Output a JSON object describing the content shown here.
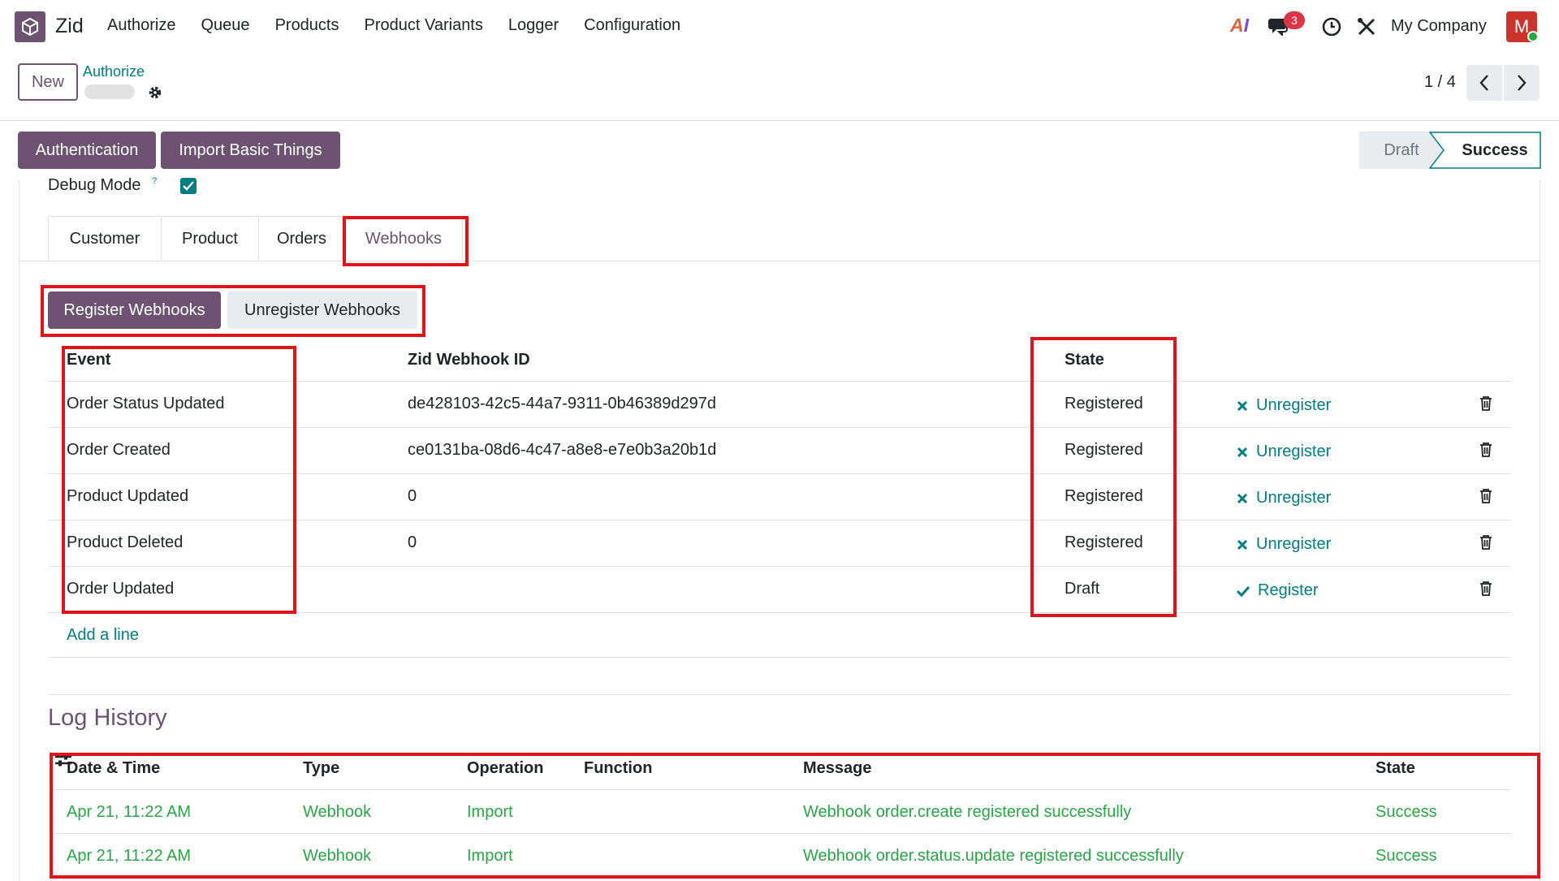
{
  "app": {
    "name": "Zid"
  },
  "nav": {
    "items": [
      "Authorize",
      "Queue",
      "Products",
      "Product Variants",
      "Logger",
      "Configuration"
    ]
  },
  "systray": {
    "chat_badge": "3",
    "company": "My Company",
    "avatar_initial": "M"
  },
  "control_panel": {
    "new_label": "New",
    "breadcrumb": "Authorize",
    "pager": "1 / 4"
  },
  "header_buttons": {
    "authentication": "Authentication",
    "import_basic": "Import Basic Things"
  },
  "statusbar": {
    "draft": "Draft",
    "success": "Success",
    "current": "Success"
  },
  "form": {
    "debug_label": "Debug Mode",
    "debug_sup": "?",
    "debug_checked": true
  },
  "tabs": [
    "Customer",
    "Product",
    "Orders",
    "Webhooks"
  ],
  "active_tab": "Webhooks",
  "webhooks": {
    "register_btn": "Register Webhooks",
    "unregister_btn": "Unregister Webhooks",
    "columns": {
      "event": "Event",
      "webhook_id": "Zid Webhook ID",
      "state": "State"
    },
    "rows": [
      {
        "event": "Order Status Updated",
        "webhook_id": "de428103-42c5-44a7-9311-0b46389d297d",
        "state": "Registered",
        "action": "Unregister"
      },
      {
        "event": "Order Created",
        "webhook_id": "ce0131ba-08d6-4c47-a8e8-e7e0b3a20b1d",
        "state": "Registered",
        "action": "Unregister"
      },
      {
        "event": "Product Updated",
        "webhook_id": "0",
        "state": "Registered",
        "action": "Unregister"
      },
      {
        "event": "Product Deleted",
        "webhook_id": "0",
        "state": "Registered",
        "action": "Unregister"
      },
      {
        "event": "Order Updated",
        "webhook_id": "",
        "state": "Draft",
        "action": "Register"
      }
    ],
    "add_line": "Add a line"
  },
  "log_history": {
    "title": "Log History",
    "columns": {
      "datetime": "Date & Time",
      "type": "Type",
      "operation": "Operation",
      "function": "Function",
      "message": "Message",
      "state": "State"
    },
    "rows": [
      {
        "datetime": "Apr 21, 11:22 AM",
        "type": "Webhook",
        "operation": "Import",
        "function": "",
        "message": "Webhook order.create registered successfully",
        "state": "Success"
      },
      {
        "datetime": "Apr 21, 11:22 AM",
        "type": "Webhook",
        "operation": "Import",
        "function": "",
        "message": "Webhook order.status.update registered successfully",
        "state": "Success"
      }
    ]
  },
  "colors": {
    "brand": "#6d5272",
    "link": "#017e84",
    "success": "#28a745",
    "annotation": "#e0131a"
  }
}
